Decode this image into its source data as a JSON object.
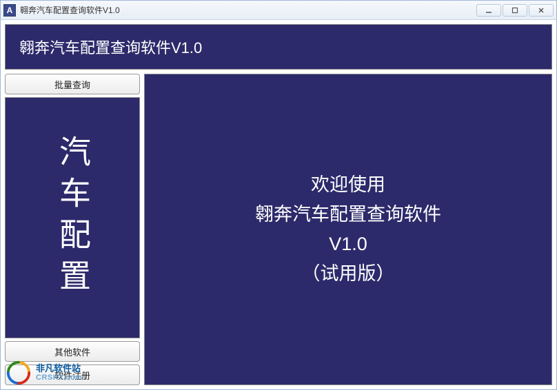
{
  "titlebar": {
    "icon_letter": "A",
    "title": "翱奔汽车配置查询软件V1.0"
  },
  "header": {
    "title": "翱奔汽车配置查询软件V1.0"
  },
  "sidebar": {
    "batch_query_label": "批量查询",
    "panel_text": "汽车配置",
    "other_software_label": "其他软件",
    "software_register_label": "软件注册"
  },
  "main": {
    "line1": "欢迎使用",
    "line2": "翱奔汽车配置查询软件",
    "line3": "V1.0",
    "line4": "（试用版）"
  },
  "watermark": {
    "cn": "非凡软件站",
    "en": "CRSKY.com"
  }
}
